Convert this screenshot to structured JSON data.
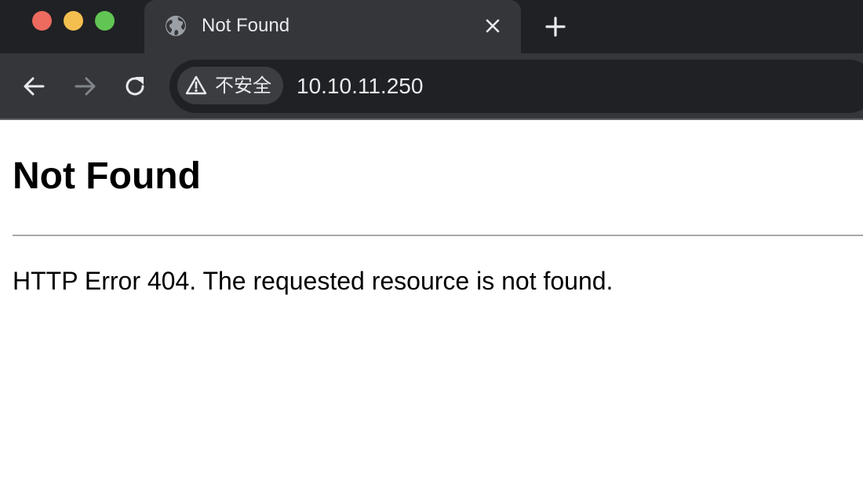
{
  "browser": {
    "tab": {
      "title": "Not Found",
      "favicon": "globe-icon",
      "close_icon": "close-icon"
    },
    "new_tab_icon": "plus-icon",
    "toolbar": {
      "back_icon": "arrow-left-icon",
      "forward_icon": "arrow-right-icon",
      "forward_enabled": false,
      "reload_icon": "reload-icon"
    },
    "omnibox": {
      "security_icon": "warning-triangle-icon",
      "security_label": "不安全",
      "url": "10.10.11.250"
    },
    "colors": {
      "frame": "#202124",
      "toolbar": "#35363a",
      "close_red": "#ec6a5e",
      "minimize_yellow": "#f4bf4f",
      "zoom_green": "#61c554"
    }
  },
  "page": {
    "heading": "Not Found",
    "message": "HTTP Error 404. The requested resource is not found."
  }
}
